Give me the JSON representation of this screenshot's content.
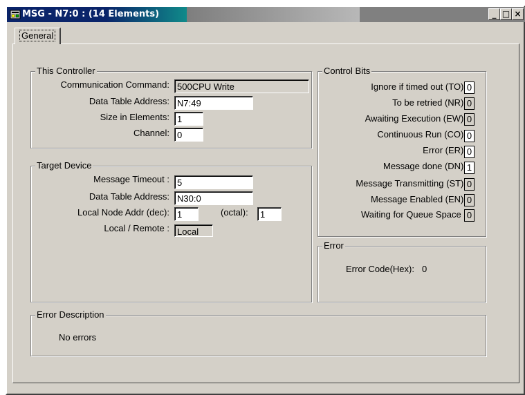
{
  "window": {
    "title_part1": "MSG - N7:0 : (14",
    "title_part2": "Elements)",
    "minimize": "_",
    "maximize": "□",
    "close": "×"
  },
  "tabs": [
    {
      "label": "General"
    }
  ],
  "this_controller": {
    "legend": "This Controller",
    "communication_command_label": "Communication Command:",
    "communication_command_value": "500CPU Write",
    "data_table_address_label": "Data Table Address:",
    "data_table_address_value": "N7:49",
    "size_in_elements_label": "Size in Elements:",
    "size_in_elements_value": "1",
    "channel_label": "Channel:",
    "channel_value": "0"
  },
  "target_device": {
    "legend": "Target Device",
    "message_timeout_label": "Message Timeout :",
    "message_timeout_value": "5",
    "data_table_address_label": "Data Table Address:",
    "data_table_address_value": "N30:0",
    "local_node_label": "Local Node Addr (dec):",
    "local_node_value": "1",
    "octal_label": "(octal):",
    "octal_value": "1",
    "local_remote_label": "Local / Remote :",
    "local_remote_value": "Local"
  },
  "control_bits": {
    "legend": "Control Bits",
    "items": [
      {
        "label": "Ignore if timed out (TO):",
        "value": "0"
      },
      {
        "label": "To be retried (NR):",
        "value": "0"
      },
      {
        "label": "Awaiting Execution (EW):",
        "value": "0"
      },
      {
        "label": "Continuous Run (CO):",
        "value": "0"
      },
      {
        "label": "Error (ER):",
        "value": "0"
      },
      {
        "label": "Message done (DN):",
        "value": "1"
      },
      {
        "label": "Message Transmitting (ST):",
        "value": "0"
      },
      {
        "label": "Message Enabled (EN):",
        "value": "0"
      },
      {
        "label": "Waiting for Queue Space :",
        "value": "0"
      }
    ]
  },
  "error": {
    "legend": "Error",
    "error_code_label": "Error Code(Hex):",
    "error_code_value": "0"
  },
  "error_description": {
    "legend": "Error Description",
    "text": "No errors"
  },
  "colors": {
    "title_active": "#0a246a",
    "face": "#d4d0c8"
  }
}
